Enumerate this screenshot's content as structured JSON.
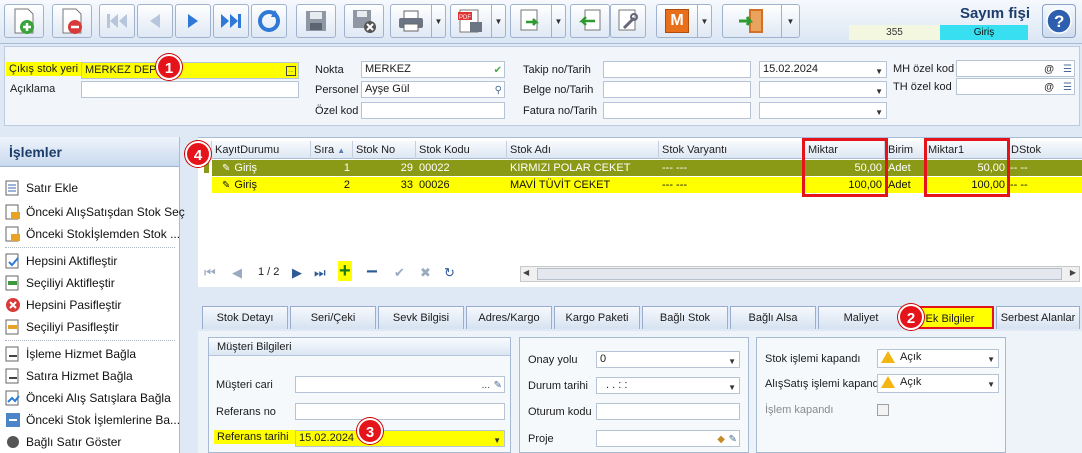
{
  "toolbar": {
    "icons": [
      "new-document-icon",
      "delete-document-icon",
      "first-record-icon",
      "previous-record-icon",
      "next-record-icon",
      "last-record-icon",
      "refresh-icon",
      "save-icon",
      "save-close-icon",
      "print-icon",
      "pdf-icon",
      "transfer-icon",
      "back-icon",
      "tools-icon",
      "m-icon",
      "exit-icon"
    ],
    "title": "Sayım fişi",
    "doc_number": "355",
    "doc_type": "Giriş",
    "m_label": "M"
  },
  "header": {
    "cikis_stok_yeri_label": "Çıkış stok yeri",
    "cikis_stok_yeri_value": "MERKEZ DEPO",
    "aciklama_label": "Açıklama",
    "aciklama_value": "",
    "nokta_label": "Nokta",
    "nokta_value": "MERKEZ",
    "personel_label": "Personel",
    "personel_value": "Ayşe Gül",
    "ozel_kod_label": "Özel kod",
    "ozel_kod_value": "",
    "takip_label": "Takip no/Tarih",
    "takip_value": "",
    "takip_date": "15.02.2024",
    "belge_label": "Belge no/Tarih",
    "belge_value": "",
    "fatura_label": "Fatura no/Tarih",
    "fatura_value": "",
    "mh_ozel_kod_label": "MH özel kod",
    "mh_ozel_kod_value": "",
    "th_ozel_kod_label": "TH özel kod",
    "th_ozel_kod_value": "",
    "field_icon_text": "...",
    "at_symbol": "@"
  },
  "badges": {
    "b1": "1",
    "b2": "2",
    "b3": "3",
    "b4": "4"
  },
  "left_panel": {
    "title": "İşlemler",
    "items": [
      "Satır Ekle",
      "Önceki AlışSatışdan Stok Seç",
      "Önceki Stokİşlemden Stok ...",
      "Hepsini Aktifleştir",
      "Seçiliyi Aktifleştir",
      "Hepsini Pasifleştir",
      "Seçiliyi Pasifleştir",
      "İşleme Hizmet Bağla",
      "Satıra Hizmet Bağla",
      "Önceki Alış Satışlara Bağla",
      "Önceki Stok İşlemlerine Ba...",
      "Bağlı Satır Göster"
    ]
  },
  "grid": {
    "columns": [
      "KayıtDurumu",
      "Sıra",
      "Stok No",
      "Stok Kodu",
      "Stok Adı",
      "Stok Varyantı",
      "Miktar",
      "Birim",
      "Miktar1",
      "DStok"
    ],
    "rows": [
      {
        "durum": "Giriş",
        "sira": "1",
        "stok_no": "29",
        "stok_kodu": "00022",
        "stok_adi": "KIRMIZI POLAR CEKET",
        "varyant": "--- ---",
        "miktar": "50,00",
        "birim": "Adet",
        "miktar1": "50,00",
        "dstok": "-- --"
      },
      {
        "durum": "Giriş",
        "sira": "2",
        "stok_no": "33",
        "stok_kodu": "00026",
        "stok_adi": "MAVİ TÜVİT CEKET",
        "varyant": "--- ---",
        "miktar": "100,00",
        "birim": "Adet",
        "miktar1": "100,00",
        "dstok": "-- --"
      }
    ],
    "pager": "1 / 2"
  },
  "tabs": [
    "Stok Detayı",
    "Seri/Çeki",
    "Sevk Bilgisi",
    "Adres/Kargo",
    "Kargo Paketi",
    "Bağlı Stok",
    "Bağlı Alsa",
    "Maliyet",
    "Ek Bilgiler",
    "Serbest Alanlar"
  ],
  "detail": {
    "musteri_group_title": "Müşteri Bilgileri",
    "musteri_cari_label": "Müşteri cari",
    "musteri_cari_value": "",
    "referans_no_label": "Referans no",
    "referans_no_value": "",
    "referans_tarihi_label": "Referans tarihi",
    "referans_tarihi_value": "15.02.2024",
    "onay_yolu_label": "Onay yolu",
    "onay_yolu_value": "0",
    "durum_tarihi_label": "Durum tarihi",
    "durum_tarihi_value": ". .     : :",
    "oturum_kodu_label": "Oturum kodu",
    "oturum_kodu_value": "",
    "proje_label": "Proje",
    "proje_value": "",
    "stok_islemi_kapandi_label": "Stok işlemi kapandı",
    "stok_islemi_kapandi_value": "Açık",
    "alissatis_kapandi_label": "AlışSatış işlemi kapandı",
    "alissatis_kapandi_value": "Açık",
    "islem_kapandi_label": "İşlem kapandı"
  },
  "colors": {
    "highlight": "#ffff00",
    "badge": "#e4141a",
    "row_selected": "#8a9a16",
    "doc_type_bg": "#38dff0"
  }
}
